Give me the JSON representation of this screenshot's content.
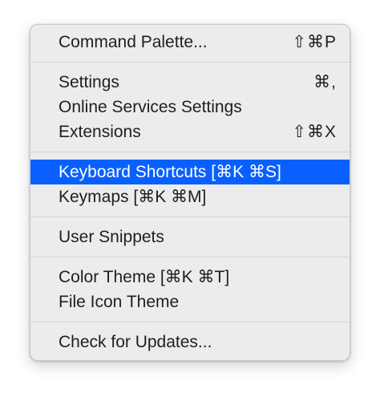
{
  "menu": {
    "groups": [
      {
        "items": [
          {
            "label": "Command Palette...",
            "shortcut": "⇧⌘P"
          }
        ]
      },
      {
        "items": [
          {
            "label": "Settings",
            "shortcut": "⌘,"
          },
          {
            "label": "Online Services Settings",
            "shortcut": ""
          },
          {
            "label": "Extensions",
            "shortcut": "⇧⌘X"
          }
        ]
      },
      {
        "items": [
          {
            "label": "Keyboard Shortcuts [⌘K ⌘S]",
            "shortcut": "",
            "highlighted": true
          },
          {
            "label": "Keymaps [⌘K ⌘M]",
            "shortcut": ""
          }
        ]
      },
      {
        "items": [
          {
            "label": "User Snippets",
            "shortcut": ""
          }
        ]
      },
      {
        "items": [
          {
            "label": "Color Theme [⌘K ⌘T]",
            "shortcut": ""
          },
          {
            "label": "File Icon Theme",
            "shortcut": ""
          }
        ]
      },
      {
        "items": [
          {
            "label": "Check for Updates...",
            "shortcut": ""
          }
        ]
      }
    ],
    "colors": {
      "highlight": "#0a60ff",
      "background": "#ececec",
      "separator": "#d2d2d2"
    }
  }
}
